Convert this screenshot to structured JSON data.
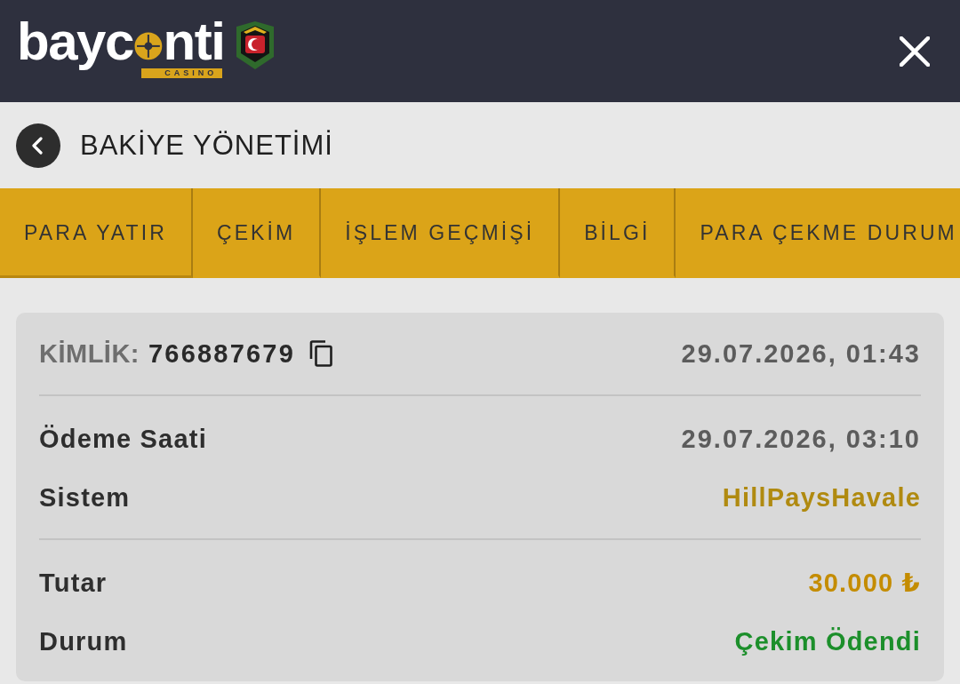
{
  "header": {
    "logo": {
      "wordmark_start": "bayc",
      "wordmark_end": "nti",
      "tagline": "CASINO"
    }
  },
  "page_title": "BAKİYE YÖNETİMİ",
  "tabs": [
    {
      "label": "PARA YATIR",
      "selected": true
    },
    {
      "label": "ÇEKİM",
      "selected": false
    },
    {
      "label": "İŞLEM GEÇMİŞİ",
      "selected": false
    },
    {
      "label": "BİLGİ",
      "selected": false
    },
    {
      "label": "PARA ÇEKME DURUM",
      "selected": false
    }
  ],
  "withdrawal": {
    "id_label": "KİMLİK:",
    "id": "766887679",
    "created": "29.07.2026, 01:43",
    "sections": [
      {
        "rows": [
          {
            "label": "Ödeme Saati",
            "value": "29.07.2026, 03:10",
            "kind": "time"
          },
          {
            "label": "Sistem",
            "value": "HillPaysHavale",
            "kind": "method"
          }
        ]
      },
      {
        "rows": [
          {
            "label": "Tutar",
            "value": "30.000 ₺",
            "kind": "amount"
          },
          {
            "label": "Durum",
            "value": "Çekim Ödendi",
            "kind": "status"
          }
        ]
      }
    ]
  }
}
